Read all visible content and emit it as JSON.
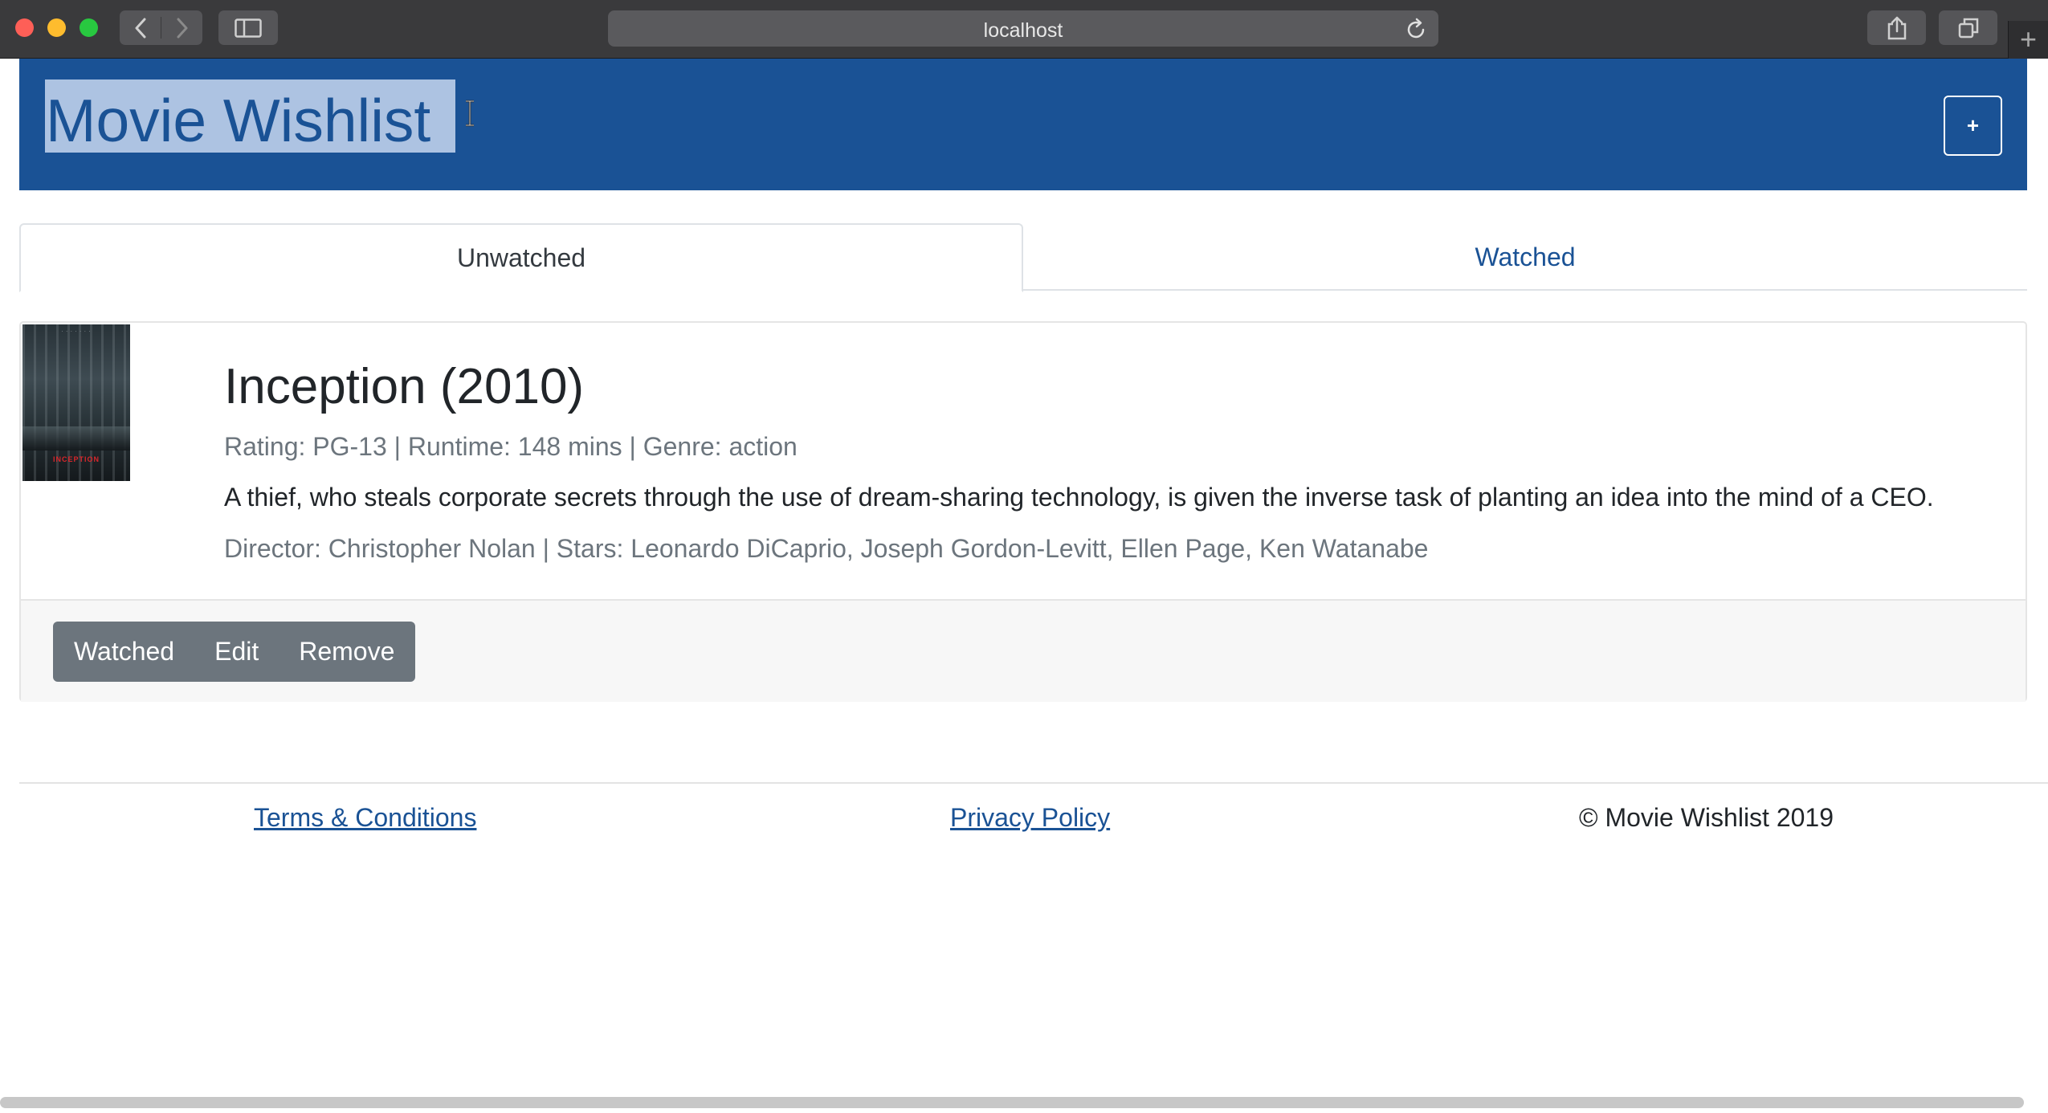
{
  "browser": {
    "url": "localhost",
    "new_tab_label": "+"
  },
  "app": {
    "brand": "Movie Wishlist",
    "add_label": "+"
  },
  "tabs": [
    {
      "label": "Unwatched",
      "active": true
    },
    {
      "label": "Watched",
      "active": false
    }
  ],
  "movie": {
    "title": "Inception (2010)",
    "meta": "Rating: PG-13 | Runtime: 148 mins | Genre: action",
    "plot": "A thief, who steals corporate secrets through the use of dream-sharing technology, is given the inverse task of planting an idea into the mind of a CEO.",
    "credits": "Director: Christopher Nolan | Stars: Leonardo DiCaprio, Joseph Gordon-Levitt, Ellen Page, Ken Watanabe",
    "poster_text": "INCEPTION",
    "actions": {
      "watched": "Watched",
      "edit": "Edit",
      "remove": "Remove"
    }
  },
  "footer": {
    "terms": "Terms & Conditions",
    "privacy": "Privacy Policy",
    "copyright": "© Movie Wishlist 2019"
  },
  "colors": {
    "navbar": "#1a5295",
    "link": "#1a5295",
    "button_group": "#6c757d",
    "selection": "#b5c9e6"
  }
}
